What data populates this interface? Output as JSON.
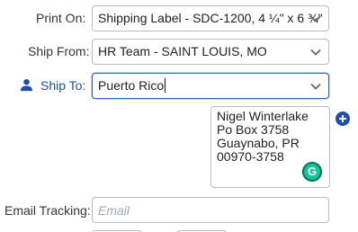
{
  "print_on": {
    "label": "Print On:",
    "value": "Shipping Label - SDC-1200, 4 ¼\" x 6 ¾\""
  },
  "ship_from": {
    "label": "Ship From:",
    "value": "HR Team - SAINT LOUIS, MO"
  },
  "ship_to": {
    "label": "Ship To:",
    "value": "Puerto Rico",
    "icon": "person-icon",
    "accent_color": "#1f4fa8"
  },
  "address": {
    "lines": [
      "Nigel Winterlake",
      "Po Box 3758",
      "Guaynabo, PR",
      "00970-3758"
    ],
    "grammarly_badge": "G"
  },
  "email_tracking": {
    "label": "Email Tracking:",
    "placeholder": "Email",
    "value": ""
  },
  "icons": {
    "dropdown": "chevron-down-icon",
    "add": "plus-circle-icon"
  }
}
